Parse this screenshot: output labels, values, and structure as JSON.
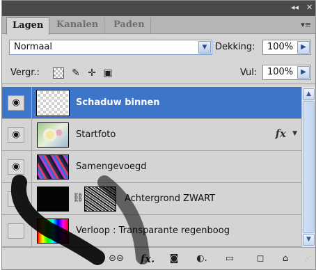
{
  "titlebar": {
    "collapse": "◂◂",
    "close": "✕"
  },
  "tabs": [
    {
      "label": "Lagen",
      "active": true
    },
    {
      "label": "Kanalen",
      "active": false
    },
    {
      "label": "Paden",
      "active": false
    }
  ],
  "tabs_menu": "▾≡",
  "blend_mode": {
    "value": "Normaal"
  },
  "opacity": {
    "label": "Dekking:",
    "value": "100%"
  },
  "lock": {
    "label": "Vergr.:",
    "icons": [
      "lock-transparency-icon",
      "lock-paint-icon",
      "lock-move-icon",
      "lock-all-icon"
    ]
  },
  "fill": {
    "label": "Vul:",
    "value": "100%"
  },
  "layers": [
    {
      "name": "Schaduw binnen",
      "visible": true,
      "selected": true
    },
    {
      "name": "Startfoto",
      "visible": true,
      "selected": false,
      "fx": "fx"
    },
    {
      "name": "Samengevoegd",
      "visible": true,
      "selected": false
    },
    {
      "name": "Achtergrond ZWART",
      "visible": false,
      "selected": false
    },
    {
      "name": "Verloop : Transparante regenboog",
      "visible": false,
      "selected": false
    }
  ],
  "bottom_icons": [
    "link-icon",
    "fx-icon",
    "mask-icon",
    "adjustment-icon",
    "folder-icon",
    "new-layer-icon",
    "trash-icon"
  ],
  "fx_label": "fx.",
  "colors": {
    "selected": "#3d76c9",
    "panel": "#d6d6d6",
    "titlebar": "#4a4a4a"
  }
}
